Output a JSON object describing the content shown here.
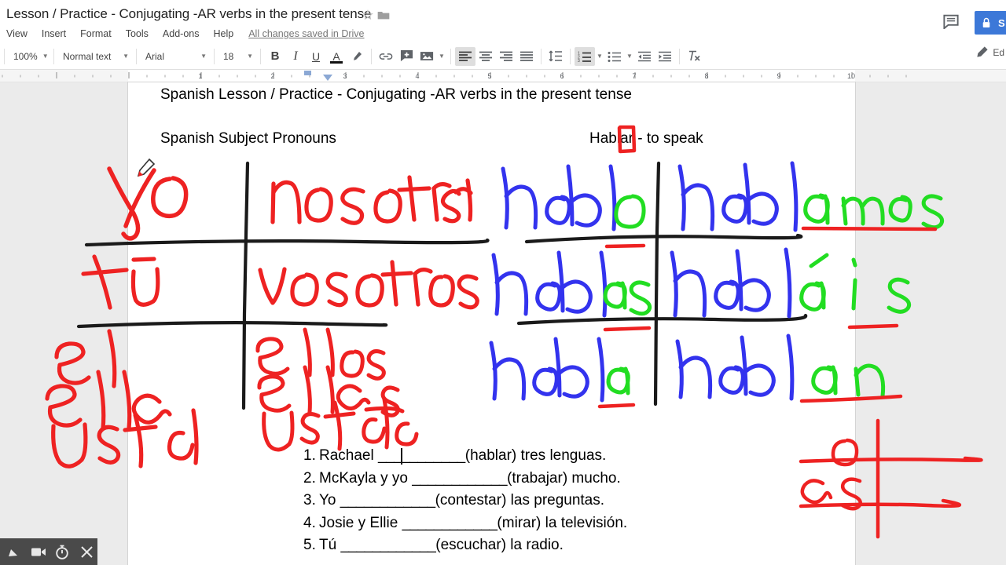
{
  "titlebar": {
    "doc_title": "Lesson / Practice - Conjugating -AR verbs in the present tense",
    "star_icon": "star-outline-icon",
    "folder_icon": "folder-icon",
    "comment_icon": "comment-icon",
    "share_label": "SHARE",
    "share_lock_icon": "lock-icon",
    "share_color": "#3c78d8"
  },
  "menubar": {
    "items": [
      {
        "label": "View"
      },
      {
        "label": "Insert"
      },
      {
        "label": "Format"
      },
      {
        "label": "Tools"
      },
      {
        "label": "Add-ons"
      },
      {
        "label": "Help"
      }
    ],
    "save_status": "All changes saved in Drive"
  },
  "toolbar": {
    "zoom_value": "100%",
    "style_value": "Normal text",
    "font_value": "Arial",
    "size_value": "18",
    "bold_label": "B",
    "italic_label": "I",
    "underline_label": "U",
    "text_color_label": "A",
    "highlight_icon": "highlighter-icon",
    "link_icon": "link-icon",
    "comment_icon": "add-comment-icon",
    "image_icon": "image-icon",
    "align_left_icon": "align-left-icon",
    "align_center_icon": "align-center-icon",
    "align_right_icon": "align-right-icon",
    "align_justify_icon": "align-justify-icon",
    "line_spacing_icon": "line-spacing-icon",
    "numbered_list_icon": "numbered-list-icon",
    "bulleted_list_icon": "bulleted-list-icon",
    "decrease_indent_icon": "decrease-indent-icon",
    "increase_indent_icon": "increase-indent-icon",
    "clear_format_icon": "clear-formatting-icon",
    "mode_label": "Ed",
    "mode_icon": "pencil-icon"
  },
  "ruler": {
    "numbers": [
      1,
      2,
      3,
      4,
      5,
      6,
      7,
      8,
      9,
      10
    ],
    "indent_marker": "indent-marker"
  },
  "document": {
    "heading": "Spanish Lesson / Practice - Conjugating -AR verbs in the present tense",
    "pronouns_header": "Spanish Subject Pronouns",
    "verb_header": "Hablar - to speak",
    "exercises": [
      {
        "num": "1.",
        "before": "Rachael ",
        "blank": "___________",
        "after": "(hablar) tres lenguas."
      },
      {
        "num": "2.",
        "before": "McKayla y yo ",
        "blank": "____________",
        "after": "(trabajar) mucho."
      },
      {
        "num": "3.",
        "before": "Yo ",
        "blank": "____________",
        "after": "(contestar) las preguntas."
      },
      {
        "num": "4.",
        "before": "Josie y Ellie ",
        "blank": "____________",
        "after": "(mirar) la televisión."
      },
      {
        "num": "5.",
        "before": "Tú ",
        "blank": "____________",
        "after": "(escuchar) la radio."
      }
    ]
  },
  "annotations": {
    "ink_red": "#ee2222",
    "ink_blue": "#3333ee",
    "ink_green": "#22dd22",
    "ink_black": "#1a1a1a",
    "pronoun_grid": {
      "cells": [
        {
          "text": "yo",
          "col": "left",
          "row": 1
        },
        {
          "text": "nosotras",
          "col": "right",
          "row": 1
        },
        {
          "text": "tú",
          "col": "left",
          "row": 2
        },
        {
          "text": "vosotros",
          "col": "right",
          "row": 2
        },
        {
          "text": "él",
          "col": "left",
          "row": 3
        },
        {
          "text": "ella",
          "col": "left",
          "row": 3
        },
        {
          "text": "usted",
          "col": "left",
          "row": 3
        },
        {
          "text": "ellos",
          "col": "right",
          "row": 3
        },
        {
          "text": "ellas",
          "col": "right",
          "row": 3
        },
        {
          "text": "ustedes",
          "col": "right",
          "row": 3
        }
      ]
    },
    "conjugation_grid": {
      "cells": [
        {
          "stem": "habl",
          "ending": "o",
          "col": "left",
          "row": 1
        },
        {
          "stem": "habl",
          "ending": "amos",
          "col": "right",
          "row": 1
        },
        {
          "stem": "habl",
          "ending": "as",
          "col": "left",
          "row": 2
        },
        {
          "stem": "habl",
          "ending": "áis",
          "col": "right",
          "row": 2
        },
        {
          "stem": "habl",
          "ending": "a",
          "col": "left",
          "row": 3
        },
        {
          "stem": "habl",
          "ending": "an",
          "col": "right",
          "row": 3
        }
      ]
    },
    "corner_grid": {
      "cells": [
        {
          "text": "o",
          "row": 1
        },
        {
          "text": "as",
          "row": 2
        }
      ]
    },
    "boxed_text": "ar",
    "cursor_icon": "pen-cursor-icon"
  },
  "recorder": {
    "pen_icon": "pen-icon",
    "camera_icon": "video-camera-icon",
    "timer_icon": "timer-icon",
    "close_icon": "close-icon"
  }
}
